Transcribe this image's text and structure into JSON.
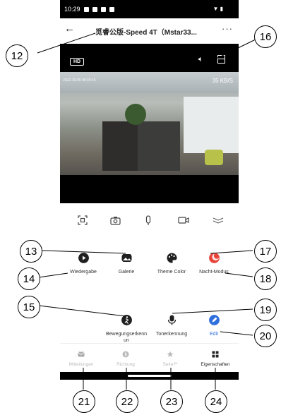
{
  "status_bar": {
    "time": "10:29"
  },
  "header": {
    "back": "←",
    "title": "觅睿公版-Speed 4T（Mstar33...",
    "more": "···"
  },
  "video": {
    "hd_badge": "HD",
    "timestamp": "2022-10-09 08:30:15",
    "bitrate": "35 KB/S"
  },
  "controls": [
    "screenshot-icon",
    "camera-icon",
    "microphone-icon",
    "video-record-icon",
    "collapse-icon"
  ],
  "features": [
    {
      "label": "Wiedergabe",
      "icon": "play-icon",
      "color": "#1f1f1f"
    },
    {
      "label": "Galerie",
      "icon": "gallery-icon",
      "color": "#1f1f1f"
    },
    {
      "label": "Theme Color",
      "icon": "palette-icon",
      "color": "#1f1f1f"
    },
    {
      "label": "Nacht-Modus",
      "icon": "night-mode-icon",
      "color": "#e8463c"
    },
    {
      "label": "Bewegungserkennun",
      "icon": "motion-detection-icon",
      "color": "#1f1f1f"
    },
    {
      "label": "Tonerkennung",
      "icon": "sound-detection-icon",
      "color": "#1f1f1f"
    },
    {
      "label": "Edit",
      "icon": "edit-icon",
      "color": "#2f6fdd"
    }
  ],
  "tabs": [
    {
      "label": "Mitteilungen",
      "icon": "message-icon"
    },
    {
      "label": "Richtung",
      "icon": "direction-icon"
    },
    {
      "label": "Seite?*",
      "icon": "star-icon"
    },
    {
      "label": "Eigenschaften",
      "icon": "grid-icon"
    }
  ],
  "callouts": [
    "12",
    "13",
    "14",
    "15",
    "16",
    "17",
    "18",
    "19",
    "20",
    "21",
    "22",
    "23",
    "24"
  ]
}
